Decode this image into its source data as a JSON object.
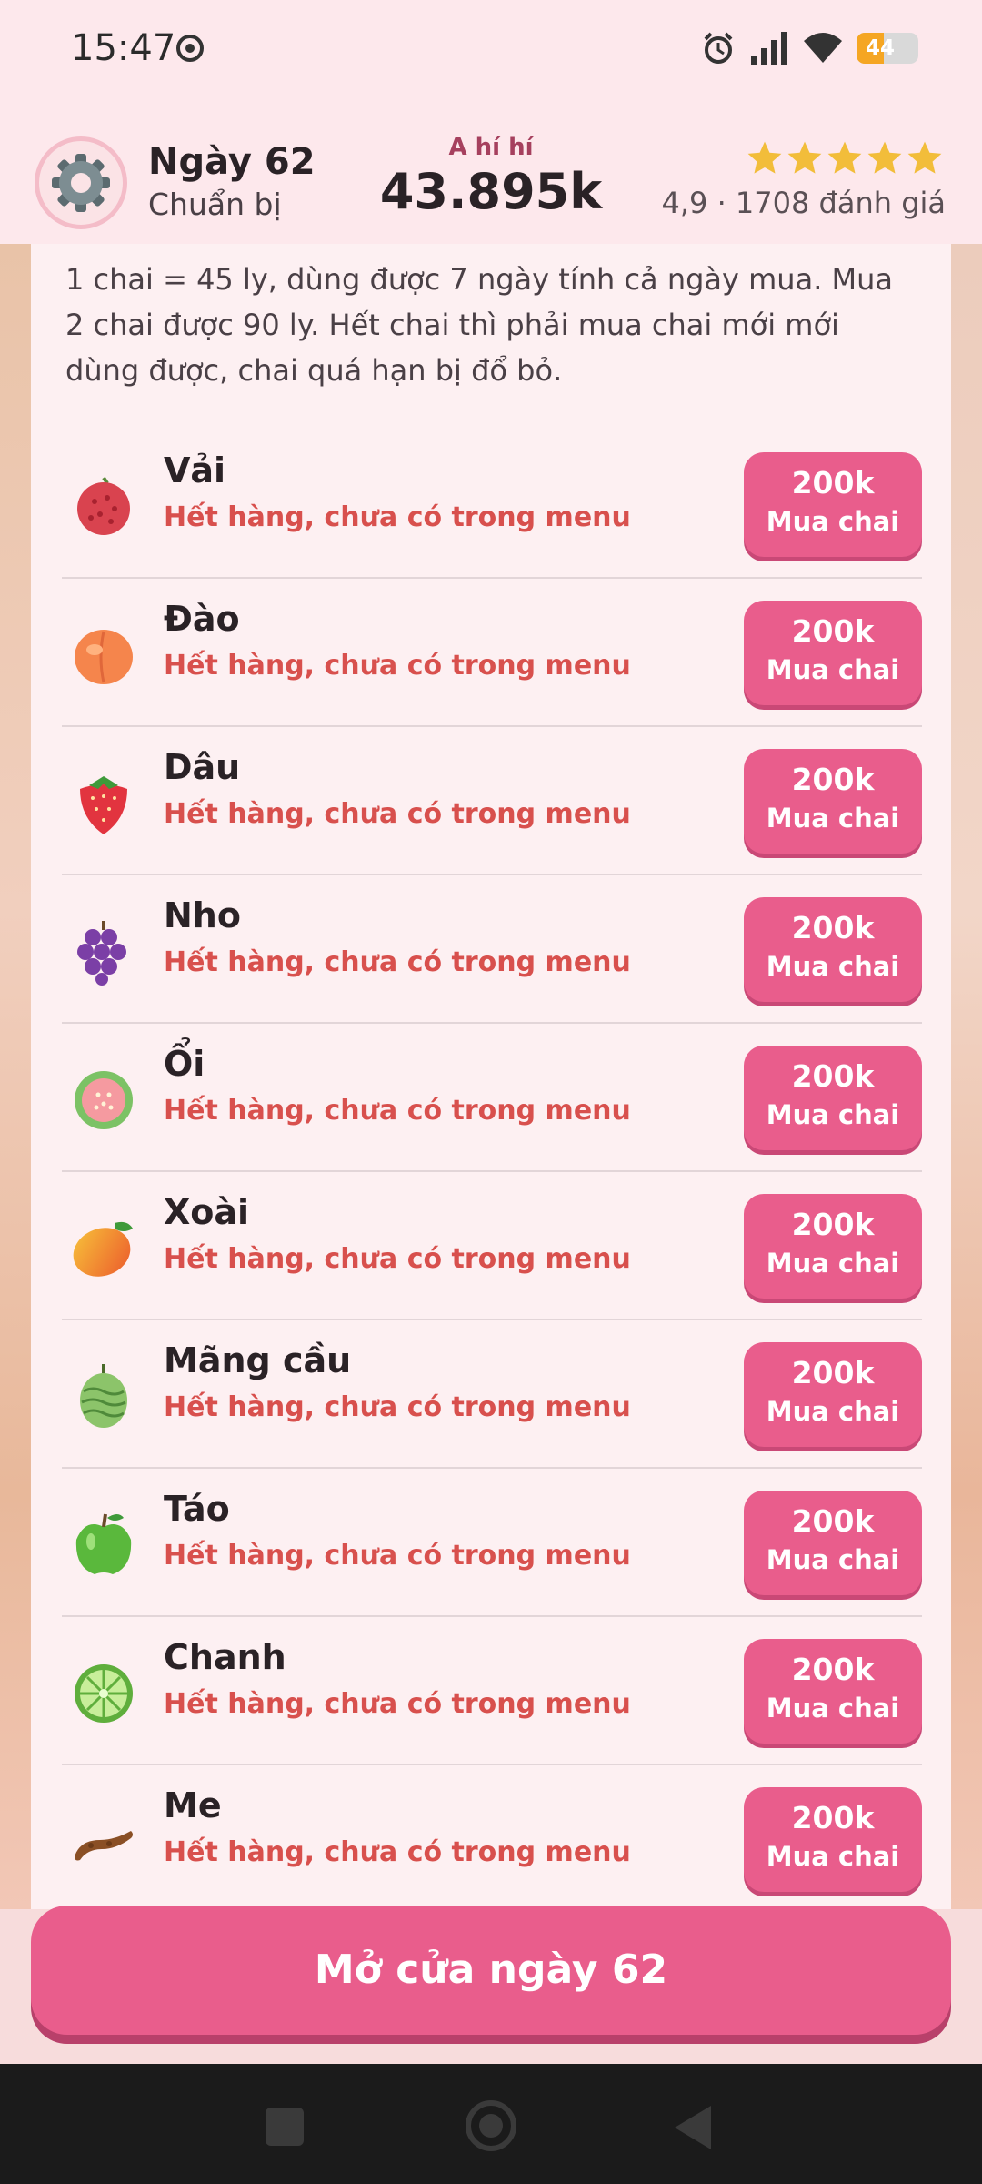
{
  "status_bar": {
    "time": "15:47",
    "battery": "44"
  },
  "header": {
    "day": "Ngày 62",
    "phase": "Chuẩn bị",
    "money_label": "A hí hí",
    "money": "43.895k",
    "rating_text": "4,9 · 1708 đánh giá",
    "stars": 5
  },
  "intro_text": "1 chai = 45 ly, dùng được 7 ngày tính cả ngày mua. Mua 2 chai được 90 ly. Hết chai thì phải mua chai mới mới dùng được, chai quá hạn bị đổ bỏ.",
  "items": [
    {
      "name": "Vải",
      "status": "Hết hàng, chưa có trong menu",
      "price": "200k",
      "button": "Mua chai",
      "icon": "lychee-icon"
    },
    {
      "name": "Đào",
      "status": "Hết hàng, chưa có trong menu",
      "price": "200k",
      "button": "Mua chai",
      "icon": "peach-icon"
    },
    {
      "name": "Dâu",
      "status": "Hết hàng, chưa có trong menu",
      "price": "200k",
      "button": "Mua chai",
      "icon": "strawberry-icon"
    },
    {
      "name": "Nho",
      "status": "Hết hàng, chưa có trong menu",
      "price": "200k",
      "button": "Mua chai",
      "icon": "grape-icon"
    },
    {
      "name": "Ổi",
      "status": "Hết hàng, chưa có trong menu",
      "price": "200k",
      "button": "Mua chai",
      "icon": "guava-icon"
    },
    {
      "name": "Xoài",
      "status": "Hết hàng, chưa có trong menu",
      "price": "200k",
      "button": "Mua chai",
      "icon": "mango-icon"
    },
    {
      "name": "Mãng cầu",
      "status": "Hết hàng, chưa có trong menu",
      "price": "200k",
      "button": "Mua chai",
      "icon": "soursop-icon"
    },
    {
      "name": "Táo",
      "status": "Hết hàng, chưa có trong menu",
      "price": "200k",
      "button": "Mua chai",
      "icon": "apple-icon"
    },
    {
      "name": "Chanh",
      "status": "Hết hàng, chưa có trong menu",
      "price": "200k",
      "button": "Mua chai",
      "icon": "lime-icon"
    },
    {
      "name": "Me",
      "status": "Hết hàng, chưa có trong menu",
      "price": "200k",
      "button": "Mua chai",
      "icon": "tamarind-icon"
    }
  ],
  "open_button": "Mở cửa ngày 62",
  "colors": {
    "accent": "#e95d8c",
    "status_red": "#d8504d",
    "background": "#fdf0f2"
  }
}
